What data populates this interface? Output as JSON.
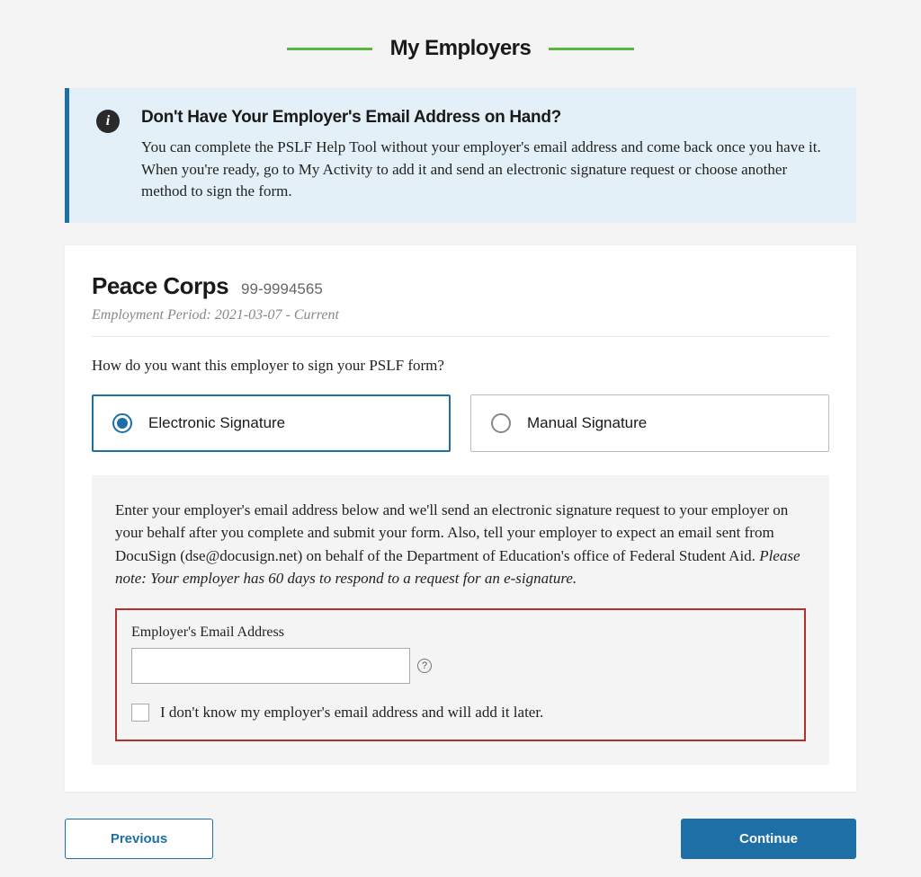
{
  "page_title": "My Employers",
  "info_banner": {
    "title": "Don't Have Your Employer's Email Address on Hand?",
    "body": "You can complete the PSLF Help Tool without your employer's email address and come back once you have it. When you're ready, go to My Activity to add it and send an electronic signature request or choose another method to sign the form."
  },
  "employer": {
    "name": "Peace Corps",
    "ein": "99-9994565",
    "period_label": "Employment Period: 2021-03-07 - Current"
  },
  "question": "How do you want this employer to sign your PSLF form?",
  "options": {
    "electronic": "Electronic Signature",
    "manual": "Manual Signature"
  },
  "detail": {
    "body_plain": "Enter your employer's email address below and we'll send an electronic signature request to your employer on your behalf after you complete and submit your form. Also, tell your employer to expect an email sent from DocuSign (dse@docusign.net) on behalf of the Department of Education's office of Federal Student Aid. ",
    "body_italic": "Please note: Your employer has 60 days to respond to a request for an e-signature.",
    "email_label": "Employer's Email Address",
    "email_value": "",
    "checkbox_label": "I don't know my employer's email address and will add it later."
  },
  "buttons": {
    "previous": "Previous",
    "continue": "Continue"
  }
}
